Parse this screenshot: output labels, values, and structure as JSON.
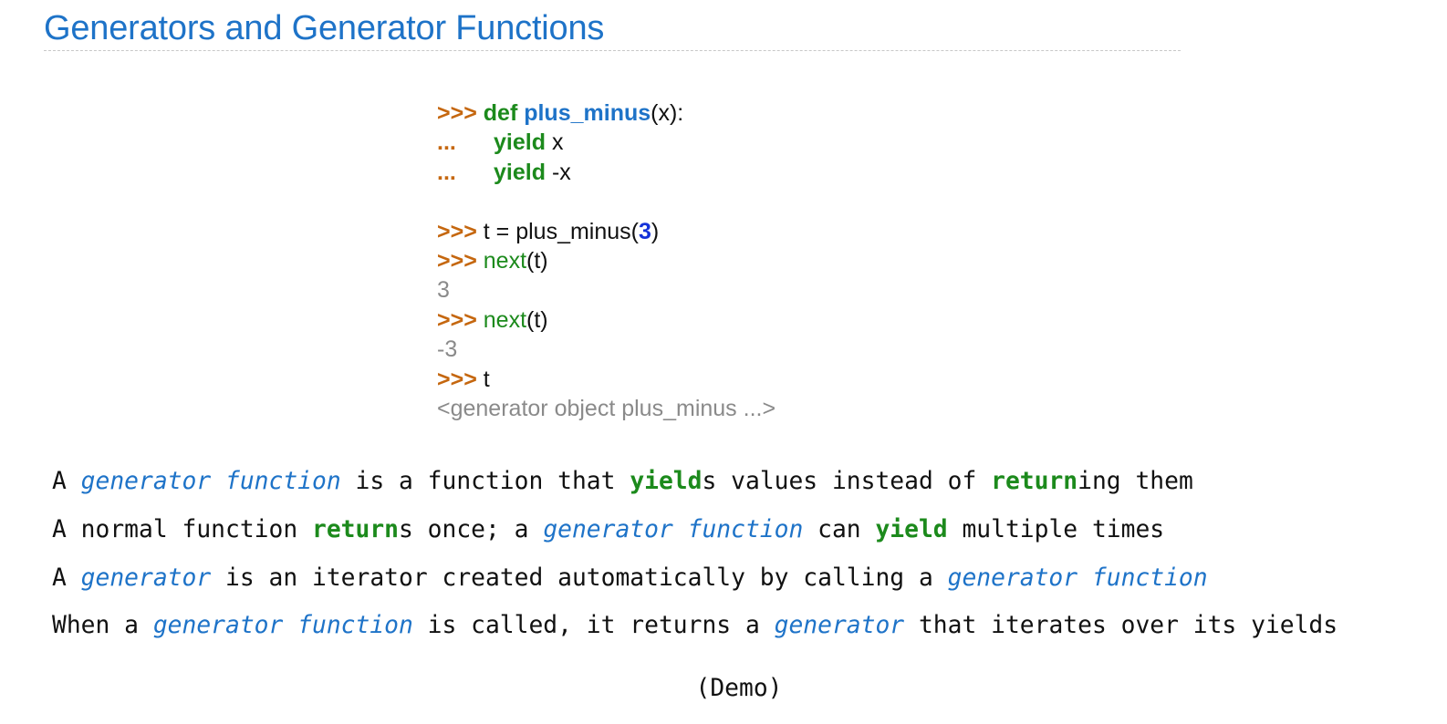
{
  "title": "Generators and Generator Functions",
  "code": {
    "prompt": ">>>",
    "continuation": "...",
    "def_kw": "def",
    "func_name": "plus_minus",
    "params": "(x):",
    "yield_kw": "yield",
    "yield1_expr": "x",
    "yield2_expr": "-x",
    "assign_prefix": "t = plus_minus(",
    "assign_arg": "3",
    "assign_suffix": ")",
    "next_fn": "next",
    "next_args": "(t)",
    "out1": "3",
    "out2": "-3",
    "t_expr": "t",
    "out3": "<generator object plus_minus ...>"
  },
  "prose": {
    "l1": [
      "A ",
      "generator function",
      " is a function that ",
      "yield",
      "s values instead of ",
      "return",
      "ing them"
    ],
    "l2": [
      "A normal function ",
      "return",
      "s once; a ",
      "generator function",
      " can ",
      "yield",
      " multiple times"
    ],
    "l3": [
      "A ",
      "generator",
      " is an iterator created automatically by calling a ",
      "generator function"
    ],
    "l4": [
      "When a ",
      "generator function",
      " is called, it returns a ",
      "generator",
      " that iterates over its yields"
    ]
  },
  "demo": "(Demo)",
  "colors": {
    "title": "#1e73c8",
    "prompt": "#c5670f",
    "keyword": "#1c8a1c",
    "term": "#1e73c8",
    "number": "#1432d9",
    "output": "#8a8a8a"
  }
}
